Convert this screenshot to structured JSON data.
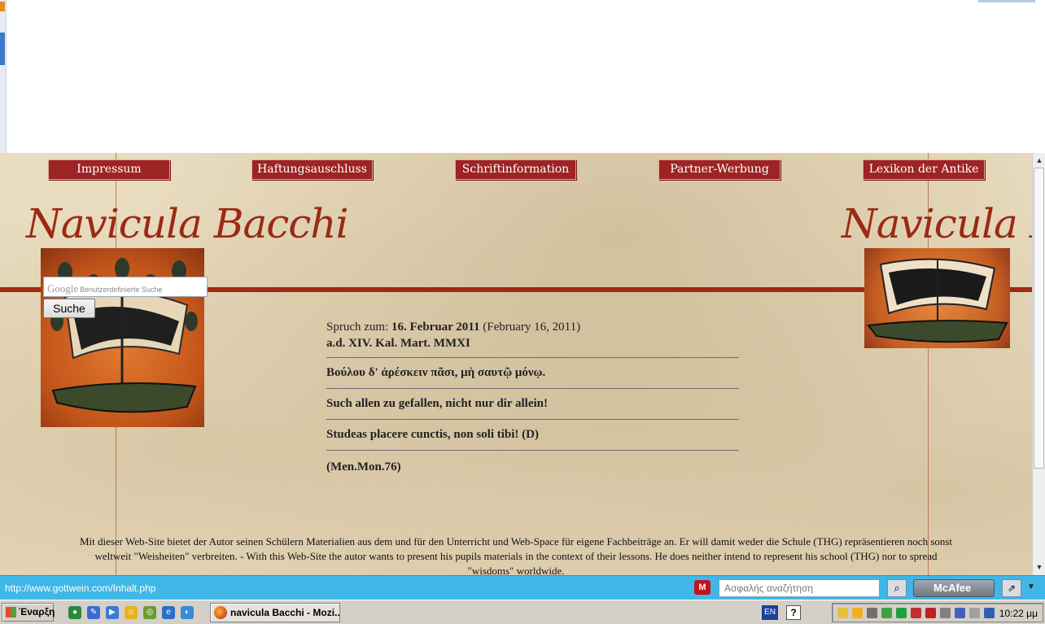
{
  "nav": [
    "Impressum",
    "Haftungsauschluss",
    "Schriftinformation",
    "Partner-Werbung",
    "Lexikon der Antike"
  ],
  "logo_text": "Navicula Bacchi",
  "search": {
    "brand": "Google",
    "placeholder": "Benutzerdefinierte Suche",
    "button": "Suche"
  },
  "quote": {
    "prefix": "Spruch zum: ",
    "date": "16. Februar 2011",
    "date_en": " (February 16, 2011)",
    "roman": "a.d. XIV. Kal. Mart. MMXI",
    "greek": "Βούλου δ' ἀρέσκειν πᾶσι, μὴ σαυτῷ μόνῳ.",
    "german": "Such allen zu gefallen, nicht nur dir allein!",
    "latin": "Studeas placere cunctis, non soli tibi! (D)",
    "source": "(Men.Mon.76)"
  },
  "disclaimer": [
    "Mit dieser Web-Site bietet der Autor seinen Schülern Materialien aus dem und für den Unterricht und Web-Space für eigene Fachbeiträge an. Er will damit weder die Schule (THG) repräsentieren noch sonst",
    "weltweit \"Weisheiten\" verbreiten. - With this  Web-Site the autor wants to present his pupils materials in the context of their lessons. He does neither intend to represent his school (THG) nor to spread",
    "\"wisdoms\" worldwide."
  ],
  "statusbar": {
    "url": "http://www.gottwein.com/Inhalt.php",
    "search_placeholder": "Ασφαλής αναζήτηση",
    "mcafee_label": "McAfee"
  },
  "taskbar": {
    "start": "Έναρξη",
    "task": "navicula Bacchi - Mozi...",
    "lang": "EN",
    "clock": "10:22 μμ"
  },
  "icons": [
    "mcafee-m-icon",
    "search-icon",
    "share-icon",
    "firefox-icon",
    "windows-flag-icon"
  ]
}
